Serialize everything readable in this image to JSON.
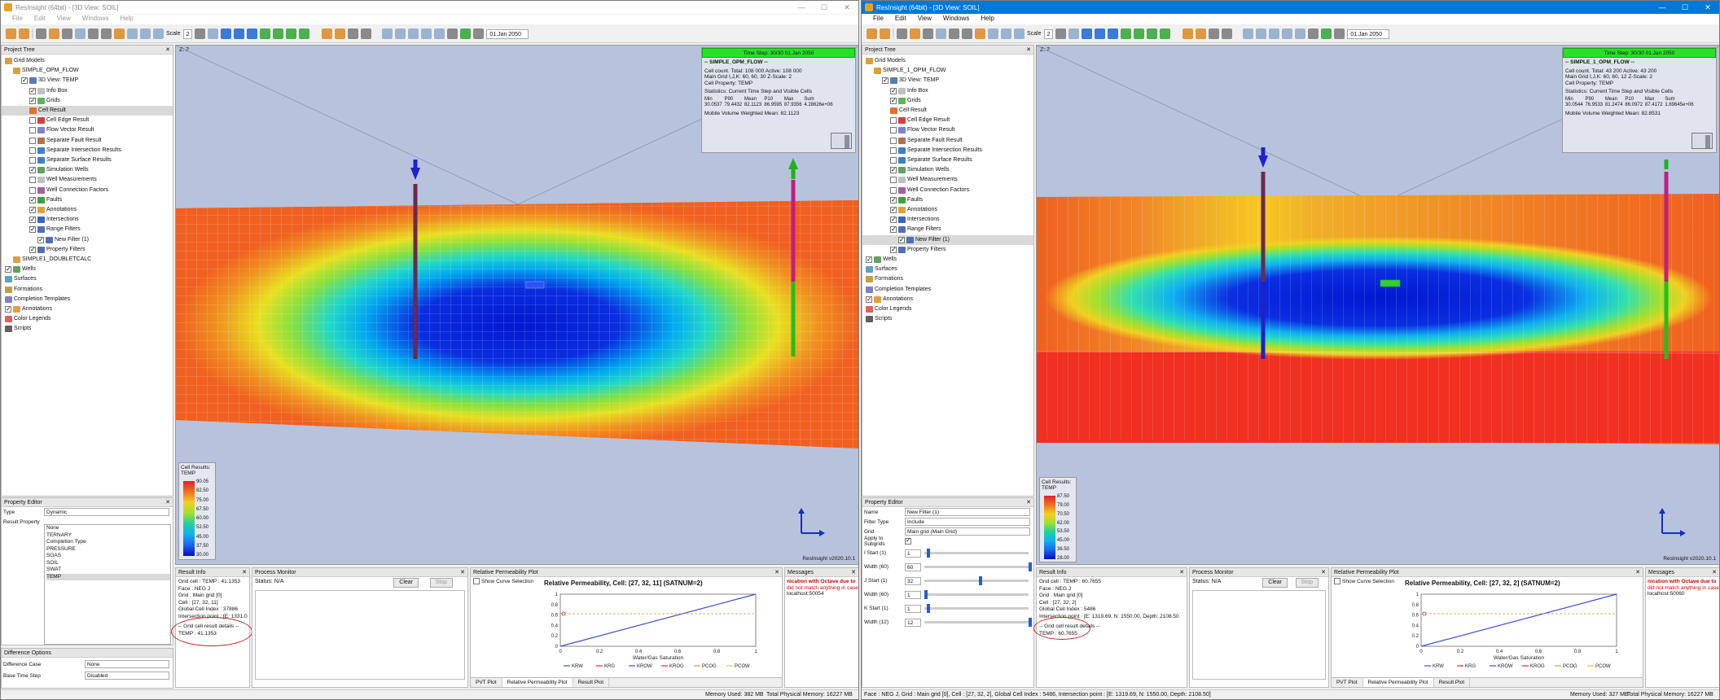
{
  "left": {
    "window_title": "ResInsight (64bit) - [3D View: SOIL]",
    "menu": [
      "File",
      "Edit",
      "View",
      "Windows",
      "Help"
    ],
    "toolbar": {
      "scale_label": "Scale",
      "scale_value": "2",
      "timestep": "01.Jan 2050"
    },
    "project_tree": {
      "title": "Project Tree",
      "items": [
        {
          "label": "Grid Models",
          "level": 0,
          "check": "none",
          "icon": "#d8a040"
        },
        {
          "label": "SIMPLE_OPM_FLOW",
          "level": 1,
          "check": "none",
          "icon": "#d8a040"
        },
        {
          "label": "3D View: TEMP",
          "level": 2,
          "check": "on",
          "icon": "#5a7bb5"
        },
        {
          "label": "Info Box",
          "level": 3,
          "check": "on",
          "icon": "#c0c0c0"
        },
        {
          "label": "Grids",
          "level": 3,
          "check": "on",
          "icon": "#5bb55b"
        },
        {
          "label": "Cell Result",
          "level": 3,
          "check": "none",
          "icon": "#e07030",
          "sel": true
        },
        {
          "label": "Cell Edge Result",
          "level": 3,
          "check": "off",
          "icon": "#d04040"
        },
        {
          "label": "Flow Vector Result",
          "level": 3,
          "check": "off",
          "icon": "#8080d0"
        },
        {
          "label": "Separate Fault Result",
          "level": 3,
          "check": "off",
          "icon": "#b07050"
        },
        {
          "label": "Separate Intersection Results",
          "level": 3,
          "check": "off",
          "icon": "#4080c0"
        },
        {
          "label": "Separate Surface Results",
          "level": 3,
          "check": "off",
          "icon": "#4080c0"
        },
        {
          "label": "Simulation Wells",
          "level": 3,
          "check": "on",
          "icon": "#60a060"
        },
        {
          "label": "Well Measurements",
          "level": 3,
          "check": "off",
          "icon": "#c0c0c0"
        },
        {
          "label": "Well Connection Factors",
          "level": 3,
          "check": "off",
          "icon": "#a060a0"
        },
        {
          "label": "Faults",
          "level": 3,
          "check": "on",
          "icon": "#40a040"
        },
        {
          "label": "Annotations",
          "level": 3,
          "check": "on",
          "icon": "#e0a040"
        },
        {
          "label": "Intersections",
          "level": 3,
          "check": "on",
          "icon": "#4060c0"
        },
        {
          "label": "Range Filters",
          "level": 3,
          "check": "on",
          "icon": "#5070b0"
        },
        {
          "label": "New Filter (1)",
          "level": 4,
          "check": "on",
          "icon": "#5070b0"
        },
        {
          "label": "Property Filters",
          "level": 3,
          "check": "on",
          "icon": "#5070b0"
        },
        {
          "label": "SIMPLE1_DOUBLETCALC",
          "level": 1,
          "check": "none",
          "icon": "#d8a040"
        },
        {
          "label": "Wells",
          "level": 0,
          "check": "on",
          "icon": "#60a060"
        },
        {
          "label": "Surfaces",
          "level": 0,
          "check": "none",
          "icon": "#60a0c0"
        },
        {
          "label": "Formations",
          "level": 0,
          "check": "none",
          "icon": "#c0a040"
        },
        {
          "label": "Completion Templates",
          "level": 0,
          "check": "none",
          "icon": "#8080c0"
        },
        {
          "label": "Annotations",
          "level": 0,
          "check": "on",
          "icon": "#e0a040"
        },
        {
          "label": "Color Legends",
          "level": 0,
          "check": "none",
          "icon": "#e06060"
        },
        {
          "label": "Scripts",
          "level": 0,
          "check": "none",
          "icon": "#606060"
        }
      ]
    },
    "property_editor": {
      "title": "Property Editor",
      "type_label": "Type",
      "type_value": "Dynamic",
      "result_property_label": "Result Property",
      "result_options": [
        "None",
        "TERNARY",
        "Completion Type",
        "PRESSURE",
        "SGAS",
        "SOIL",
        "SWAT",
        "TEMP"
      ],
      "selected_option": "TEMP"
    },
    "difference_options": {
      "title": "Difference Options",
      "case_label": "Difference Case",
      "case_value": "None",
      "base_label": "Base Time Step",
      "base_value": "Disabled"
    },
    "viewport": {
      "label": "Z: 2",
      "info": {
        "timestep": "Time Step: 30/30 01.Jan 2050",
        "case": "-- SIMPLE_OPM_FLOW --",
        "line1": "Cell count. Total: 108 000  Active: 108 000",
        "line2": "Main Grid I,J,K: 60, 60, 30  Z-Scale: 2",
        "line3": "Cell Property: TEMP",
        "stats_title": "Statistics: Current Time Step and Visible Cells",
        "stats_head": [
          "Min",
          "P90",
          "Mean",
          "P10",
          "Max",
          "Sum",
          ""
        ],
        "stats_vals": [
          "30.0537",
          "79.4432",
          "82.1123",
          "86.9595",
          "87.9356",
          "4.28626e+06",
          ""
        ],
        "mobile": "Mobile Volume Weighted Mean: 82.1123"
      },
      "legend": {
        "title": "Cell Results:",
        "prop": "TEMP",
        "labels": [
          "90.05",
          "82.50",
          "75.00",
          "67.50",
          "60.00",
          "52.50",
          "45.00",
          "37.50",
          "30.00"
        ]
      },
      "version": "ResInsight v2020.10.1"
    },
    "result_info": {
      "title": "Result Info",
      "lines": [
        "Grid cell : TEMP : 41.1353",
        "Face : NEG J",
        "Grid : Main grid [0]",
        "Cell : [27, 32, 11]",
        "Global Cell Index : 37886",
        "Intersection point : [E: 1331.0"
      ],
      "detail_header": "-- Grid cell result details --",
      "detail_value": "TEMP : 41.1353"
    },
    "process_monitor": {
      "title": "Process Monitor",
      "status_label": "Status:",
      "status_value": "N/A",
      "clear": "Clear",
      "stop": "Stop"
    },
    "relperm": {
      "title": "Relative Permeability Plot",
      "show_curve": "Show Curve Selection",
      "plot_title": "Relative Permeability, Cell: [27, 32, 11] (SATNUM=2)",
      "x_label": "Water/Gas Saturation",
      "legend": [
        "KRW",
        "KRG",
        "KROW",
        "KROG",
        "PCOG",
        "PCOW"
      ]
    },
    "messages": {
      "title": "Messages",
      "lines": [
        "nication with Octave due to",
        "did not match anything in case",
        "localhost:50054"
      ]
    },
    "bottom_tabs": [
      "PVT Plot",
      "Relative Permeability Plot",
      "Result Plot"
    ],
    "status": {
      "memory": "Memory Used: 382 MB",
      "physical": "Total Physical Memory: 16227 MB"
    }
  },
  "right": {
    "window_title": "ResInsight (64bit) - [3D View: SOIL]",
    "menu": [
      "File",
      "Edit",
      "View",
      "Windows",
      "Help"
    ],
    "toolbar": {
      "scale_label": "Scale",
      "scale_value": "2",
      "timestep": "01.Jan 2050"
    },
    "project_tree": {
      "title": "Project Tree",
      "items": [
        {
          "label": "Grid Models",
          "level": 0,
          "check": "none",
          "icon": "#d8a040"
        },
        {
          "label": "SIMPLE_1_OPM_FLOW",
          "level": 1,
          "check": "none",
          "icon": "#d8a040"
        },
        {
          "label": "3D View: TEMP",
          "level": 2,
          "check": "on",
          "icon": "#5a7bb5"
        },
        {
          "label": "Info Box",
          "level": 3,
          "check": "on",
          "icon": "#c0c0c0"
        },
        {
          "label": "Grids",
          "level": 3,
          "check": "on",
          "icon": "#5bb55b"
        },
        {
          "label": "Cell Result",
          "level": 3,
          "check": "none",
          "icon": "#e07030"
        },
        {
          "label": "Cell Edge Result",
          "level": 3,
          "check": "off",
          "icon": "#d04040"
        },
        {
          "label": "Flow Vector Result",
          "level": 3,
          "check": "off",
          "icon": "#8080d0"
        },
        {
          "label": "Separate Fault Result",
          "level": 3,
          "check": "off",
          "icon": "#b07050"
        },
        {
          "label": "Separate Intersection Results",
          "level": 3,
          "check": "off",
          "icon": "#4080c0"
        },
        {
          "label": "Separate Surface Results",
          "level": 3,
          "check": "off",
          "icon": "#4080c0"
        },
        {
          "label": "Simulation Wells",
          "level": 3,
          "check": "on",
          "icon": "#60a060"
        },
        {
          "label": "Well Measurements",
          "level": 3,
          "check": "off",
          "icon": "#c0c0c0"
        },
        {
          "label": "Well Connection Factors",
          "level": 3,
          "check": "off",
          "icon": "#a060a0"
        },
        {
          "label": "Faults",
          "level": 3,
          "check": "on",
          "icon": "#40a040"
        },
        {
          "label": "Annotations",
          "level": 3,
          "check": "on",
          "icon": "#e0a040"
        },
        {
          "label": "Intersections",
          "level": 3,
          "check": "on",
          "icon": "#4060c0"
        },
        {
          "label": "Range Filters",
          "level": 3,
          "check": "on",
          "icon": "#5070b0"
        },
        {
          "label": "New Filter (1)",
          "level": 4,
          "check": "on",
          "icon": "#5070b0",
          "sel": true
        },
        {
          "label": "Property Filters",
          "level": 3,
          "check": "on",
          "icon": "#5070b0"
        },
        {
          "label": "Wells",
          "level": 0,
          "check": "on",
          "icon": "#60a060"
        },
        {
          "label": "Surfaces",
          "level": 0,
          "check": "none",
          "icon": "#60a0c0"
        },
        {
          "label": "Formations",
          "level": 0,
          "check": "none",
          "icon": "#c0a040"
        },
        {
          "label": "Completion Templates",
          "level": 0,
          "check": "none",
          "icon": "#8080c0"
        },
        {
          "label": "Annotations",
          "level": 0,
          "check": "on",
          "icon": "#e0a040"
        },
        {
          "label": "Color Legends",
          "level": 0,
          "check": "none",
          "icon": "#e06060"
        },
        {
          "label": "Scripts",
          "level": 0,
          "check": "none",
          "icon": "#606060"
        }
      ]
    },
    "property_editor": {
      "title": "Property Editor",
      "rows": [
        {
          "label": "Name",
          "value": "New Filter (1)"
        },
        {
          "label": "Filter Type",
          "value": "Include"
        },
        {
          "label": "Grid",
          "value": "Main grid (Main Grid)"
        }
      ],
      "apply_subgrids": "Apply to Subgrids",
      "sliders": [
        {
          "label": "I Start (1)",
          "value": "1",
          "fraction": 0.02
        },
        {
          "label": "Width (60)",
          "value": "60",
          "fraction": 1.0
        },
        {
          "label": "J Start (1)",
          "value": "32",
          "fraction": 0.52
        },
        {
          "label": "Width (60)",
          "value": "1",
          "fraction": 0.0
        },
        {
          "label": "K Start (1)",
          "value": "1",
          "fraction": 0.02
        },
        {
          "label": "Width (12)",
          "value": "12",
          "fraction": 1.0
        }
      ],
      "slider_values_right": [
        "60",
        "32",
        "60",
        "1",
        "12"
      ]
    },
    "viewport": {
      "label": "Z: 2",
      "info": {
        "timestep": "Time Step: 30/30 01.Jan 2050",
        "case": "-- SIMPLE_1_OPM_FLOW --",
        "line1": "Cell count. Total: 43 200  Active: 43 200",
        "line2": "Main Grid I,J,K: 60, 60, 12  Z-Scale: 2",
        "line3": "Cell Property: TEMP",
        "stats_title": "Statistics: Current Time Step and Visible Cells",
        "stats_head": [
          "Min",
          "P90",
          "Mean",
          "P10",
          "Max",
          "Sum",
          ""
        ],
        "stats_vals": [
          "30.0544",
          "76.9533",
          "81.2474",
          "86.0972",
          "87.4172",
          "1.69645e+06",
          ""
        ],
        "mobile": "Mobile Volume Weighted Mean: 82.8531"
      },
      "legend": {
        "title": "Cell Results:",
        "prop": "TEMP",
        "labels": [
          "87.50",
          "79.00",
          "70.50",
          "62.00",
          "53.50",
          "45.00",
          "36.50",
          "28.00"
        ]
      },
      "version": "ResInsight v2020.10.1"
    },
    "result_info": {
      "title": "Result Info",
      "lines": [
        "Grid cell : TEMP : 60.7655",
        "Face : NEG J",
        "Grid : Main grid [0]",
        "Cell : [27, 32, 2]",
        "Global Cell Index : 5486",
        "Intersection point : [E: 1319.69, N: 1550.00, Depth: 2108.50"
      ],
      "detail_header": "-- Grid cell result details --",
      "detail_value": "TEMP : 60.7655"
    },
    "process_monitor": {
      "title": "Process Monitor",
      "status_label": "Status:",
      "status_value": "N/A",
      "clear": "Clear",
      "stop": "Stop"
    },
    "relperm": {
      "title": "Relative Permeability Plot",
      "show_curve": "Show Curve Selection",
      "plot_title": "Relative Permeability, Cell: [27, 32, 2] (SATNUM=2)",
      "x_label": "Water/Gas Saturation",
      "legend": [
        "KRW",
        "KRG",
        "KROW",
        "KROG",
        "PCOG",
        "PCOW"
      ]
    },
    "messages": {
      "title": "Messages",
      "lines": [
        "nication with Octave due to",
        "did not match anything in case",
        "localhost:50060"
      ]
    },
    "bottom_tabs": [
      "PVT Plot",
      "Relative Permeability Plot",
      "Result Plot"
    ],
    "status": {
      "left": "Face : NEG J, Grid : Main grid [0], Cell : [27, 32, 2], Global Cell Index : 5486, Intersection point : [E: 1319.69, N: 1550.00, Depth: 2108.50]",
      "memory": "Memory Used: 327 MB",
      "physical": "Total Physical Memory: 16227 MB"
    }
  },
  "axis_tick_labels": [
    "0",
    "0.2",
    "0.4",
    "0.6",
    "0.8",
    "1"
  ]
}
